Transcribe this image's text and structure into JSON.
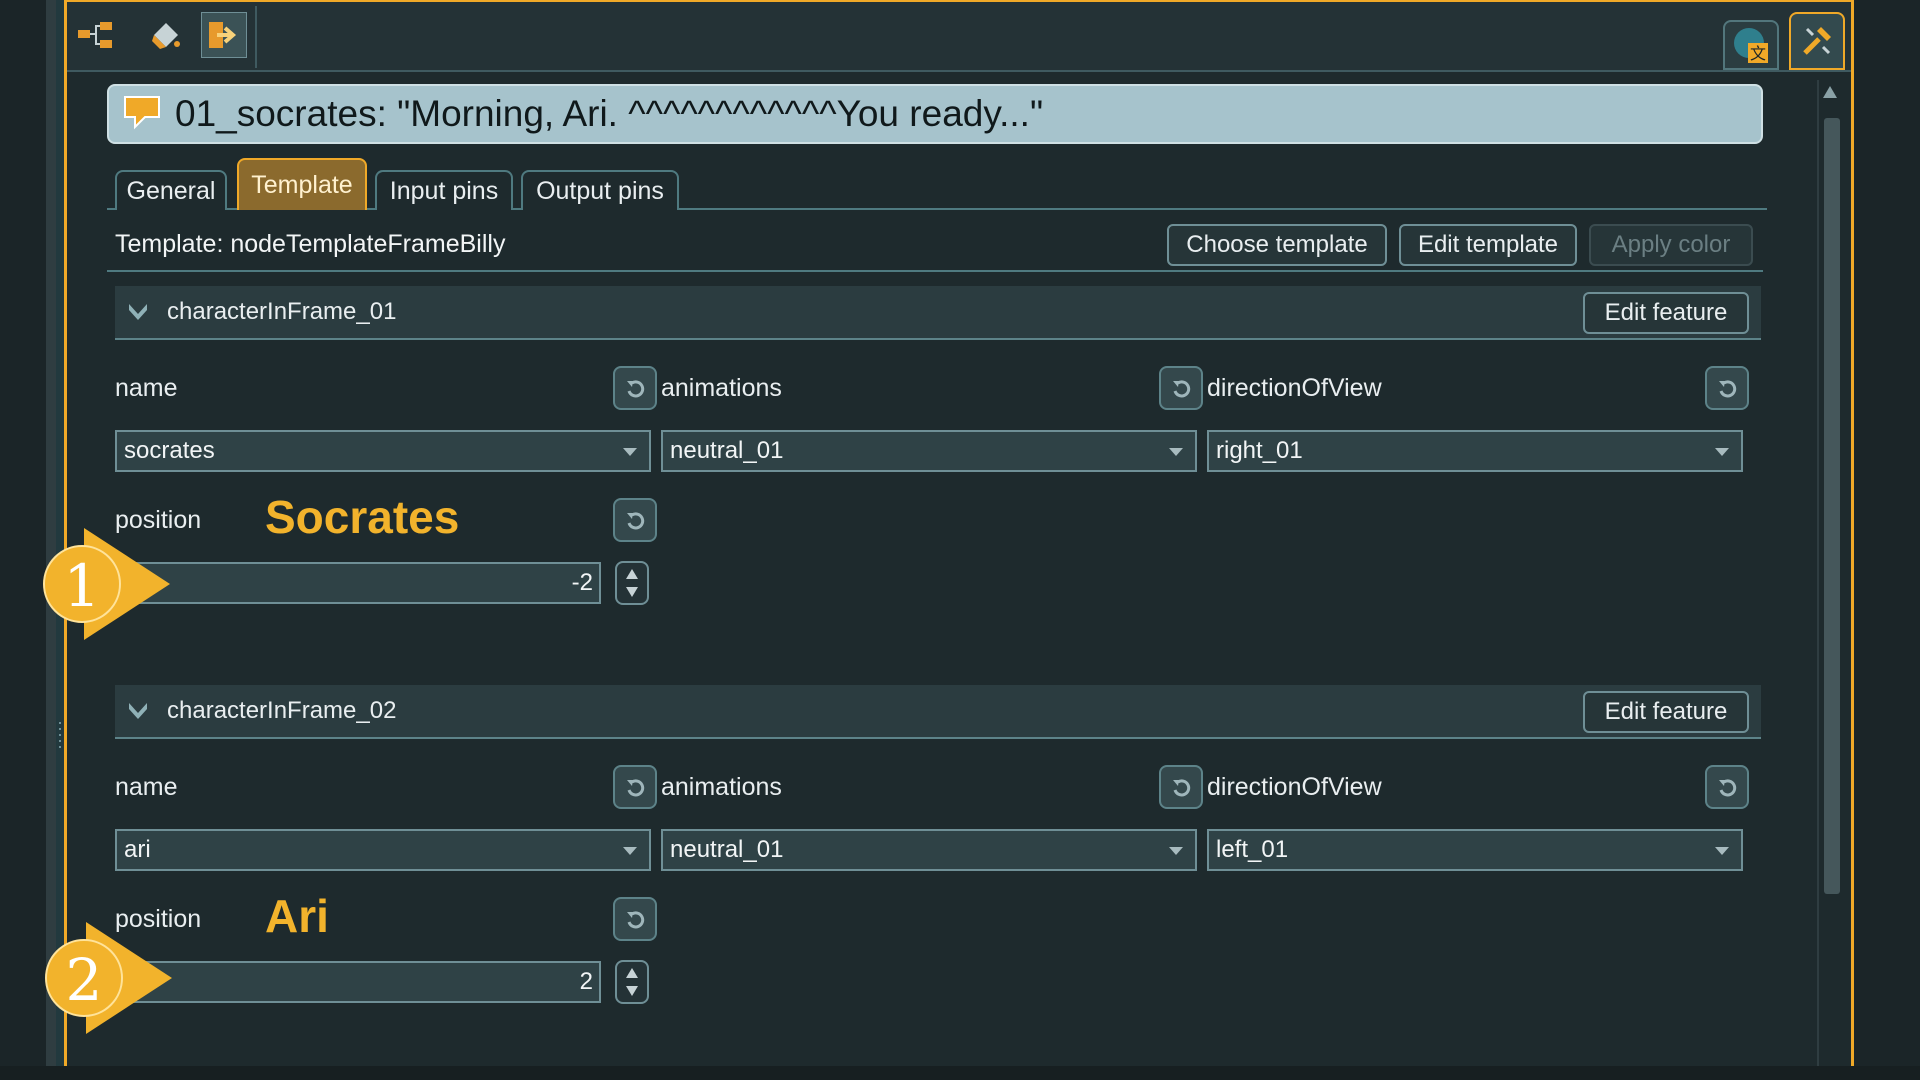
{
  "toolbar": {
    "left_icons": [
      "flow-layout-icon",
      "paint-bucket-icon",
      "exit-arrow-icon"
    ],
    "right_icons": [
      "globe-translate-icon",
      "wrench-tools-icon"
    ]
  },
  "node": {
    "title": "01_socrates: \"Morning, Ari. ^^^^^^^^^^^^You ready...\""
  },
  "tabs": [
    "General",
    "Template",
    "Input pins",
    "Output pins"
  ],
  "active_tab": "Template",
  "template": {
    "label": "Template: nodeTemplateFrameBilly",
    "choose_label": "Choose template",
    "edit_label": "Edit template",
    "apply_label": "Apply color"
  },
  "features": [
    {
      "title": "characterInFrame_01",
      "edit_label": "Edit feature",
      "name_label": "name",
      "animations_label": "animations",
      "direction_label": "directionOfView",
      "position_label": "position",
      "name_value": "socrates",
      "animations_value": "neutral_01",
      "direction_value": "right_01",
      "position_value": "-2",
      "annotation": "Socrates",
      "marker": "1"
    },
    {
      "title": "characterInFrame_02",
      "edit_label": "Edit feature",
      "name_label": "name",
      "animations_label": "animations",
      "direction_label": "directionOfView",
      "position_label": "position",
      "name_value": "ari",
      "animations_value": "neutral_01",
      "direction_value": "left_01",
      "position_value": "2",
      "annotation": "Ari",
      "marker": "2"
    }
  ],
  "colors": {
    "accent": "#f0a928",
    "annotation": "#f2b32c",
    "background": "#1e2a2d",
    "title_bar": "#a6c3cc"
  }
}
